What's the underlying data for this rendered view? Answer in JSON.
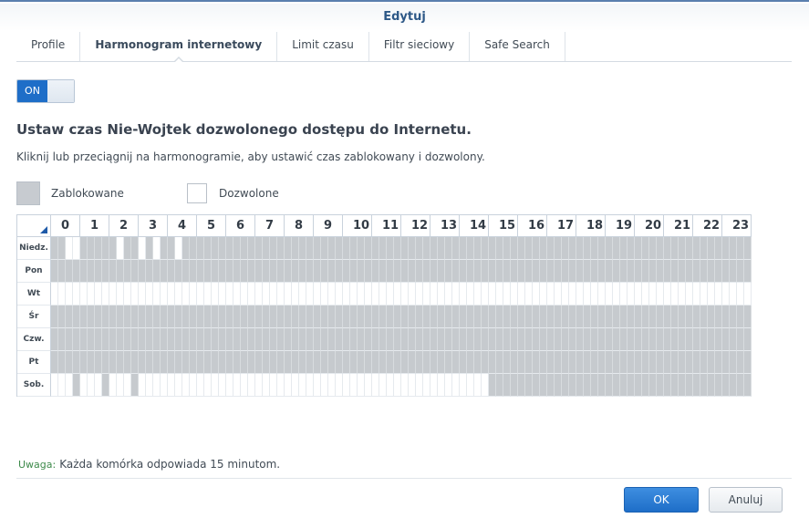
{
  "window": {
    "title": "Edytuj"
  },
  "tabs": [
    {
      "label": "Profile",
      "active": false
    },
    {
      "label": "Harmonogram internetowy",
      "active": true
    },
    {
      "label": "Limit czasu",
      "active": false
    },
    {
      "label": "Filtr sieciowy",
      "active": false
    },
    {
      "label": "Safe Search",
      "active": false
    }
  ],
  "toggle": {
    "label": "ON",
    "state": "on"
  },
  "heading": "Ustaw czas Nie-Wojtek dozwolonego dostępu do Internetu.",
  "description": "Kliknij lub przeciągnij na harmonogramie, aby ustawić czas zablokowany i dozwolony.",
  "legend": {
    "blocked": "Zablokowane",
    "allowed": "Dozwolone"
  },
  "schedule": {
    "hours": [
      "0",
      "1",
      "2",
      "3",
      "4",
      "5",
      "6",
      "7",
      "8",
      "9",
      "10",
      "11",
      "12",
      "13",
      "14",
      "15",
      "16",
      "17",
      "18",
      "19",
      "20",
      "21",
      "22",
      "23"
    ],
    "days": [
      "Niedz.",
      "Pon",
      "Wt",
      "Śr",
      "Czw.",
      "Pt",
      "Sob."
    ],
    "colors": {
      "blocked": "#c6cace",
      "allowed": "#ffffff"
    },
    "rows": [
      "110011111011010110111111111111111111111111111111111111111111111111111111111111111111111111111111",
      "111111111111111111111111111111111111111111111111111111111111111111111111111111111111111111111111",
      "000000000000000000000000000000000000000000000000000000000000000000000000000000000000000000000000",
      "111111111111111111111111111111111111111111111111111111111111111111111111111111111111111111111111",
      "111111111111111111111111111111111111111111111111111111111111111111111111111111111111111111111111",
      "111111111111111111111111111111111111111111111111111111111111111111111111111111111111111111111111",
      "000100010001000000000000000000000000000000000000000000000000111111111111111111111111111111111111"
    ]
  },
  "note": {
    "label": "Uwaga:",
    "text": "Każda komórka odpowiada 15 minutom."
  },
  "buttons": {
    "ok": "OK",
    "cancel": "Anuluj"
  },
  "accent_color": "#1e6ec8"
}
